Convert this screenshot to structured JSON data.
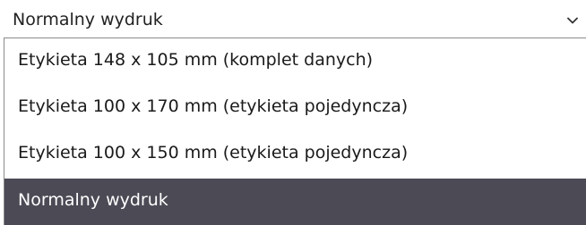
{
  "select": {
    "value": "Normalny wydruk",
    "chevron_icon": "chevron-down-icon",
    "options": [
      {
        "label": "Etykieta 148 x 105 mm (komplet danych)",
        "selected": false
      },
      {
        "label": "Etykieta 100 x 170 mm (etykieta pojedyncza)",
        "selected": false
      },
      {
        "label": "Etykieta 100 x 150 mm (etykieta pojedyncza)",
        "selected": false
      },
      {
        "label": "Normalny wydruk",
        "selected": true
      }
    ]
  },
  "colors": {
    "selected_background": "#4b4a55",
    "selected_text": "#ffffff",
    "text": "#1a1a1a",
    "border": "#8a8a8a"
  }
}
